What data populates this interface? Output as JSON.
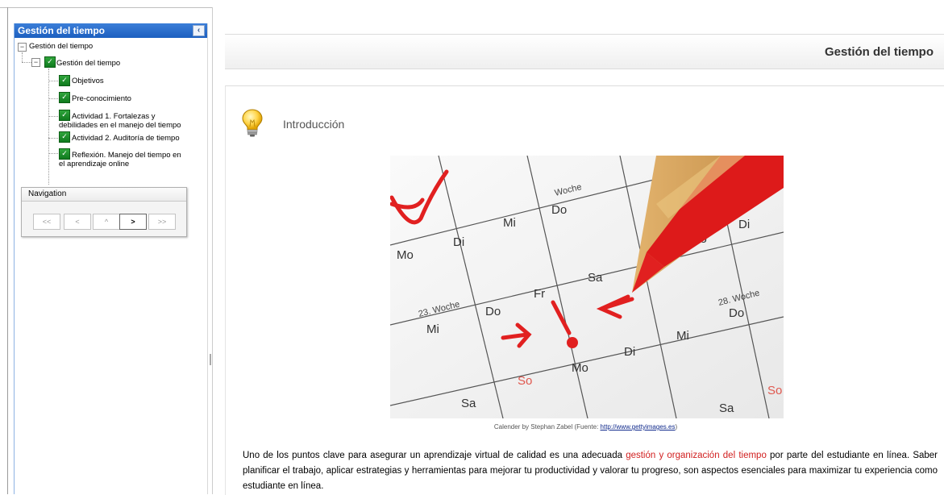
{
  "sidebar": {
    "header_title": "Gestión del tiempo",
    "collapse_icon": "‹",
    "tree": {
      "root_label": "Gestión del tiempo",
      "module_label": "Gestión del tiempo",
      "items": [
        {
          "label": "Objetivos"
        },
        {
          "label": "Pre-conocimiento"
        },
        {
          "label_line1": "Actividad 1. Fortalezas y",
          "label_line2": "debilidades en el manejo del tiempo"
        },
        {
          "label": "Actividad 2. Auditoría de tiempo"
        },
        {
          "label_line1": "Reflexión. Manejo del tiempo en",
          "label_line2": "el aprendizaje online"
        }
      ]
    },
    "navigation": {
      "title": "Navigation",
      "buttons": [
        "<<",
        "<",
        "^",
        ">",
        ">>"
      ]
    }
  },
  "main": {
    "page_title": "Gestión del tiempo",
    "section_title": "Introducción",
    "image_caption_prefix": "Calender by Stephan Zabel (Fuente: ",
    "image_caption_link": "http://www.gettyimages.es",
    "image_caption_suffix": ")",
    "paragraph_before": "Uno de los puntos clave para asegurar un aprendizaje virtual de calidad es una adecuada ",
    "paragraph_highlight": "gestión y organización del tiempo",
    "paragraph_after": " por parte del estudiante en línea. Saber planificar el trabajo, aplicar estrategias y herramientas para mejorar tu productividad y valorar tu progreso, son aspectos esenciales para maximizar tu experiencia como estudiante en línea.",
    "calendar_text": {
      "week1": "23. Woche",
      "week2": "28. Woche",
      "week3": "Woche",
      "mo": "Mo",
      "di": "Di",
      "mi": "Mi",
      "do": "Do",
      "fr": "Fr",
      "sa": "Sa",
      "so": "So"
    }
  },
  "colors": {
    "header_blue": "#1c5fc0",
    "highlight_red": "#d11f1f",
    "link_blue": "#102a8c"
  }
}
